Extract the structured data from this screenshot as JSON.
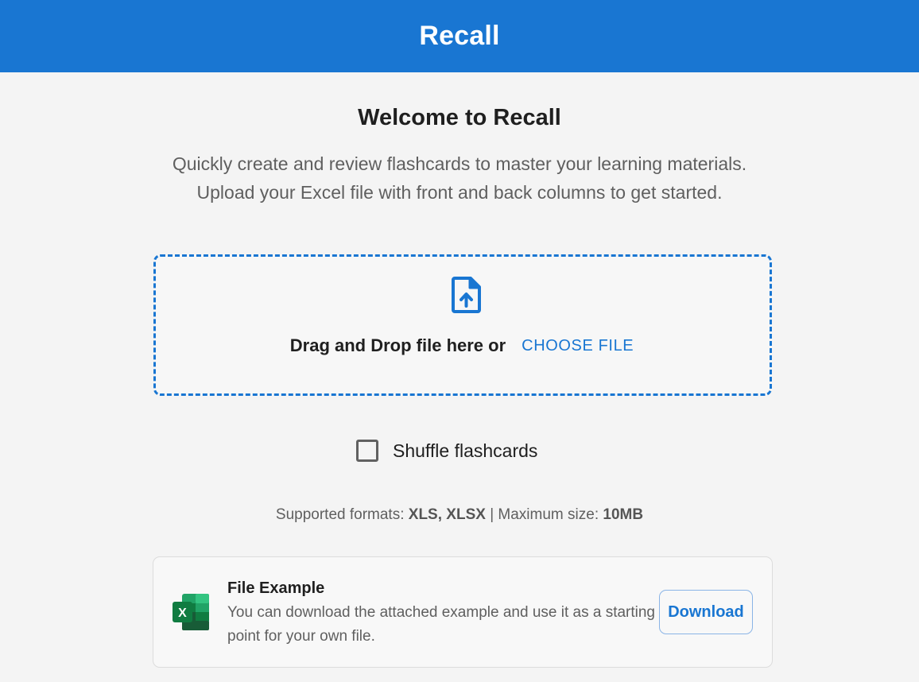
{
  "app": {
    "title": "Recall"
  },
  "welcome": {
    "heading": "Welcome to Recall",
    "line1": "Quickly create and review flashcards to master your learning materials.",
    "line2": "Upload your Excel file with front and back columns to get started."
  },
  "dropzone": {
    "icon": "file-upload-icon",
    "text": "Drag and Drop file here or",
    "choose_label": "CHOOSE FILE"
  },
  "shuffle": {
    "label": "Shuffle flashcards",
    "checked": false
  },
  "formats": {
    "formats_prefix": "Supported formats: ",
    "formats_value": "XLS, XLSX",
    "separator": " | Maximum size: ",
    "size_value": "10MB"
  },
  "example": {
    "icon": "excel-icon",
    "title": "File Example",
    "description": "You can download the attached example and use it as a starting point for your own file.",
    "download_label": "Download"
  },
  "colors": {
    "primary": "#1976d2",
    "background": "#f4f4f4"
  }
}
